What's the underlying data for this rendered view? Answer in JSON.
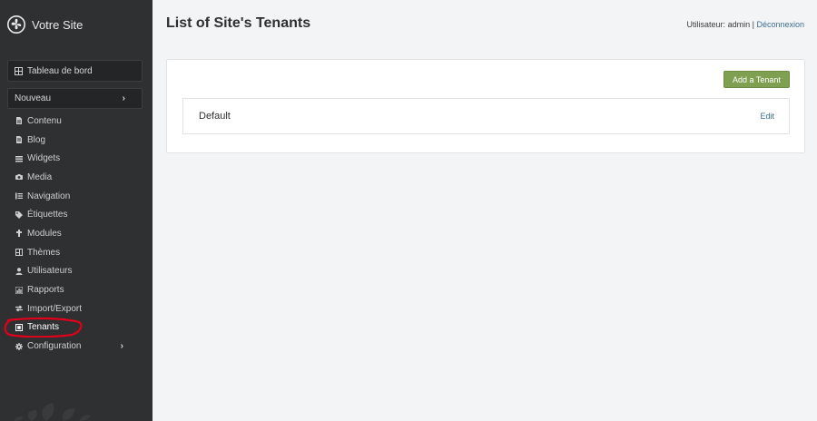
{
  "brand": {
    "name": "Votre Site"
  },
  "sidebar": {
    "dashboard_label": "Tableau de bord",
    "new_label": "Nouveau",
    "items": [
      {
        "label": "Contenu",
        "icon": "file-icon"
      },
      {
        "label": "Blog",
        "icon": "blog-icon"
      },
      {
        "label": "Widgets",
        "icon": "list-icon"
      },
      {
        "label": "Media",
        "icon": "camera-icon"
      },
      {
        "label": "Navigation",
        "icon": "nav-list-icon"
      },
      {
        "label": "Étiquettes",
        "icon": "tag-icon"
      },
      {
        "label": "Modules",
        "icon": "puzzle-icon"
      },
      {
        "label": "Thèmes",
        "icon": "theme-icon"
      },
      {
        "label": "Utilisateurs",
        "icon": "user-icon"
      },
      {
        "label": "Rapports",
        "icon": "chart-icon"
      },
      {
        "label": "Import/Export",
        "icon": "exchange-icon"
      },
      {
        "label": "Tenants",
        "icon": "tenant-icon"
      },
      {
        "label": "Configuration",
        "icon": "gear-icon"
      }
    ]
  },
  "page": {
    "title": "List of Site's Tenants"
  },
  "userbar": {
    "prefix": "Utilisateur:",
    "username": "admin",
    "separator": "|",
    "logout": "Déconnexion"
  },
  "actions": {
    "add_label": "Add a Tenant"
  },
  "tenants": [
    {
      "name": "Default",
      "edit_label": "Edit"
    }
  ],
  "colors": {
    "sidebar_bg": "#2f3031",
    "accent_green": "#7fa051",
    "link_blue": "#3a6d95",
    "highlight_red": "#e0001a"
  }
}
